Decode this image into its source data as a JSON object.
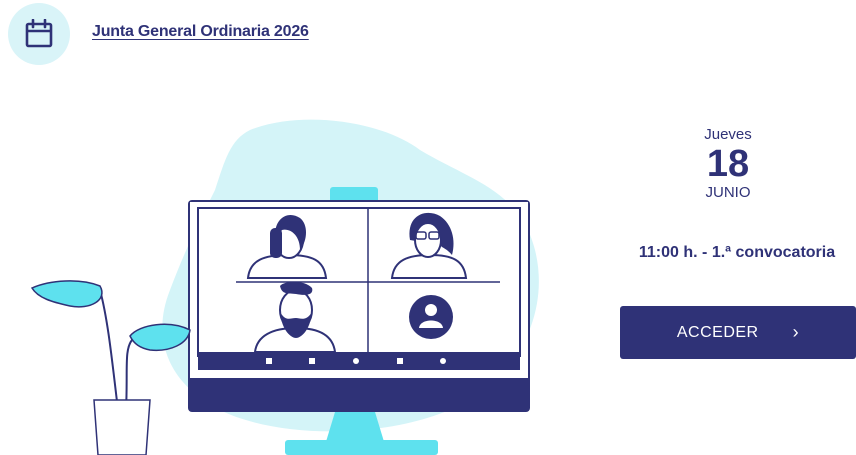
{
  "header": {
    "calendar_icon": "calendar-icon",
    "meeting_title": "Junta General Ordinaria 2026"
  },
  "event": {
    "weekday": "Jueves",
    "day": "18",
    "month": "JUNIO",
    "time": "11:00 h. - 1.ª convocatoria"
  },
  "actions": {
    "access_label": "ACCEDER",
    "access_icon": "chevron-right-icon"
  },
  "colors": {
    "brand": "#2f3277",
    "accent_light": "#d4f4f8",
    "accent": "#5ee1ee"
  }
}
